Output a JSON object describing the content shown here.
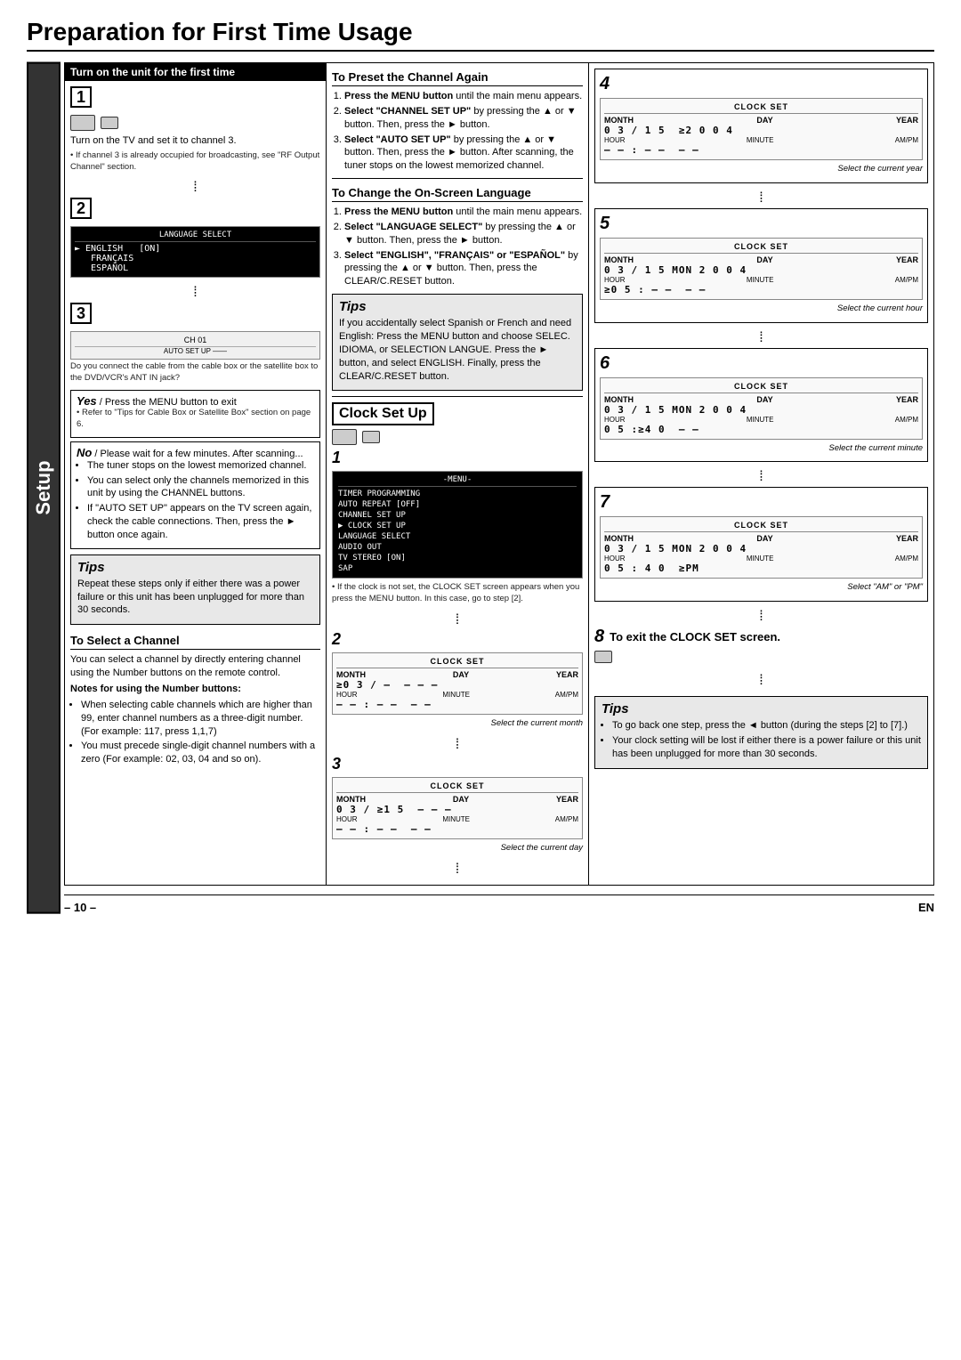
{
  "page": {
    "title": "Preparation for First Time Usage",
    "page_number": "– 10 –",
    "lang": "EN"
  },
  "setup_tab": "Setup",
  "sections": {
    "turn_on": {
      "header": "Turn on the unit for the first time",
      "step1_text": "Turn on the TV and set it to channel 3.",
      "step1_note": "• If channel 3 is already occupied for broadcasting, see \"RF Output Channel\" section.",
      "step2_label": "2",
      "step3_label": "3",
      "step3_caption": "Do you connect the cable from the cable box or the satellite box to the DVD/VCR's ANT IN jack?",
      "yes_text": "Yes Press the MENU button to exit",
      "yes_note": "• Refer to \"Tips for Cable Box or Satellite Box\" section on page 6.",
      "no_text": "No Please wait for a few minutes. After scanning...",
      "no_bullets": [
        "The tuner stops on the lowest memorized channel.",
        "You can select only the channels memorized in this unit by using the CHANNEL buttons.",
        "If \"AUTO SET UP\" appears on the TV screen again, check the cable connections. Then, press the ► button once again."
      ],
      "tips_title": "Tips",
      "tips_text": "Repeat these steps only if either there was a power failure or this unit has been unplugged for more than 30 seconds."
    },
    "to_select_channel": {
      "header": "To Select a Channel",
      "body": "You can select a channel by directly entering channel using the Number buttons on the remote control.",
      "notes_header": "Notes for using the Number buttons:",
      "notes": [
        "When selecting cable channels which are higher than 99, enter channel numbers as a three-digit number.(For example: 117, press 1,1,7)",
        "You must precede single-digit channel numbers with a zero (For example: 02, 03, 04 and so on)."
      ]
    },
    "to_preset": {
      "header": "To Preset the Channel Again",
      "steps": [
        "Press the MENU button until the main menu appears.",
        "Select \"CHANNEL SET UP\" by pressing the ▲ or ▼ button. Then, press the ► button.",
        "Select \"AUTO SET UP\" by pressing the ▲ or ▼ button. Then, press the ► button. After scanning, the tuner stops on the lowest memorized channel."
      ]
    },
    "to_change_language": {
      "header": "To Change the On-Screen Language",
      "steps": [
        "Press the MENU button until the main menu appears.",
        "Select \"LANGUAGE SELECT\" by pressing the ▲ or ▼ button. Then, press the ► button.",
        "Select \"ENGLISH\", \"FRANÇAIS\" or \"ESPAÑOL\" by pressing the ▲ or ▼ button. Then, press the CLEAR/C.RESET button."
      ]
    },
    "tips_language": {
      "title": "Tips",
      "text": "If you accidentally select Spanish or French and need English: Press the MENU button and choose SELEC. IDIOMA, or SELECTION LANGUE. Press the ► button, and select ENGLISH. Finally, press the CLEAR/C.RESET button."
    },
    "clock_set_up": {
      "header": "Clock Set Up",
      "step1_note": "• If the clock is not set, the CLOCK SET screen appears when you press the MENU button. In this case, go to step [2].",
      "menu_items": [
        "TIMER PROGRAMMING",
        "AUTO REPEAT [OFF]",
        "CHANNEL SET UP",
        "► CLOCK SET UP",
        "LANGUAGE SELECT",
        "AUDIO OUT",
        "TV STEREO [ON]",
        "SAP"
      ]
    },
    "clock_steps": {
      "step2": {
        "label": "2",
        "caption": "Select the current month",
        "clock_display": {
          "title": "CLOCK SET",
          "month": "0 3",
          "day": "/ —",
          "year": "—  ——",
          "hour": "——",
          "minute": ":",
          "ampm": "——"
        }
      },
      "step3": {
        "label": "3",
        "caption": "Select the current day",
        "clock_display": {
          "title": "CLOCK SET",
          "month": "0 3",
          "day": "/ 1 5",
          "year": "——",
          "hour": "——  :  ——",
          "ampm": "——"
        }
      },
      "step4": {
        "label": "4",
        "caption": "Select the current year",
        "clock_display": {
          "title": "CLOCK SET",
          "line1": "MONTH  DAY       YEAR",
          "line2": "0 3  /  1 5     ≥2004",
          "line3": "HOUR  MINUTE  AM/PM",
          "line4": "——  :  ——      ——"
        }
      },
      "step5": {
        "label": "5",
        "caption": "Select the current hour",
        "clock_display": {
          "title": "CLOCK SET",
          "line1": "MONTH  DAY       YEAR",
          "line2": "0 3  /  1 5  MON 2 0 0 4",
          "line3": "HOUR  MINUTE  AM/PM",
          "line4": "≥0 5  :  ——      ——"
        }
      },
      "step6": {
        "label": "6",
        "caption": "Select the current minute",
        "clock_display": {
          "title": "CLOCK SET",
          "line1": "MONTH  DAY       YEAR",
          "line2": "0 3  /  1 5  MON 2 0 0 4",
          "line3": "HOUR  MINUTE  AM/PM",
          "line4": "0 5  : ≥4 0      ——"
        }
      },
      "step7": {
        "label": "7",
        "caption": "Select \"AM\" or \"PM\"",
        "clock_display": {
          "title": "CLOCK SET",
          "line1": "MONTH  DAY       YEAR",
          "line2": "0 3  /  1 5  MON 2 0 0 4",
          "line3": "HOUR  MINUTE  AM/PM",
          "line4": "0 5  :  4 0    ≥PM"
        }
      },
      "step8": {
        "label": "8",
        "caption": "To exit the CLOCK SET screen."
      }
    },
    "tips_clock": {
      "title": "Tips",
      "items": [
        "To go back one step, press the ◄ button (during the steps [2] to [7].)",
        "Your clock setting will be lost if either there is a power failure or this unit has been unplugged for more than 30 seconds."
      ]
    }
  }
}
